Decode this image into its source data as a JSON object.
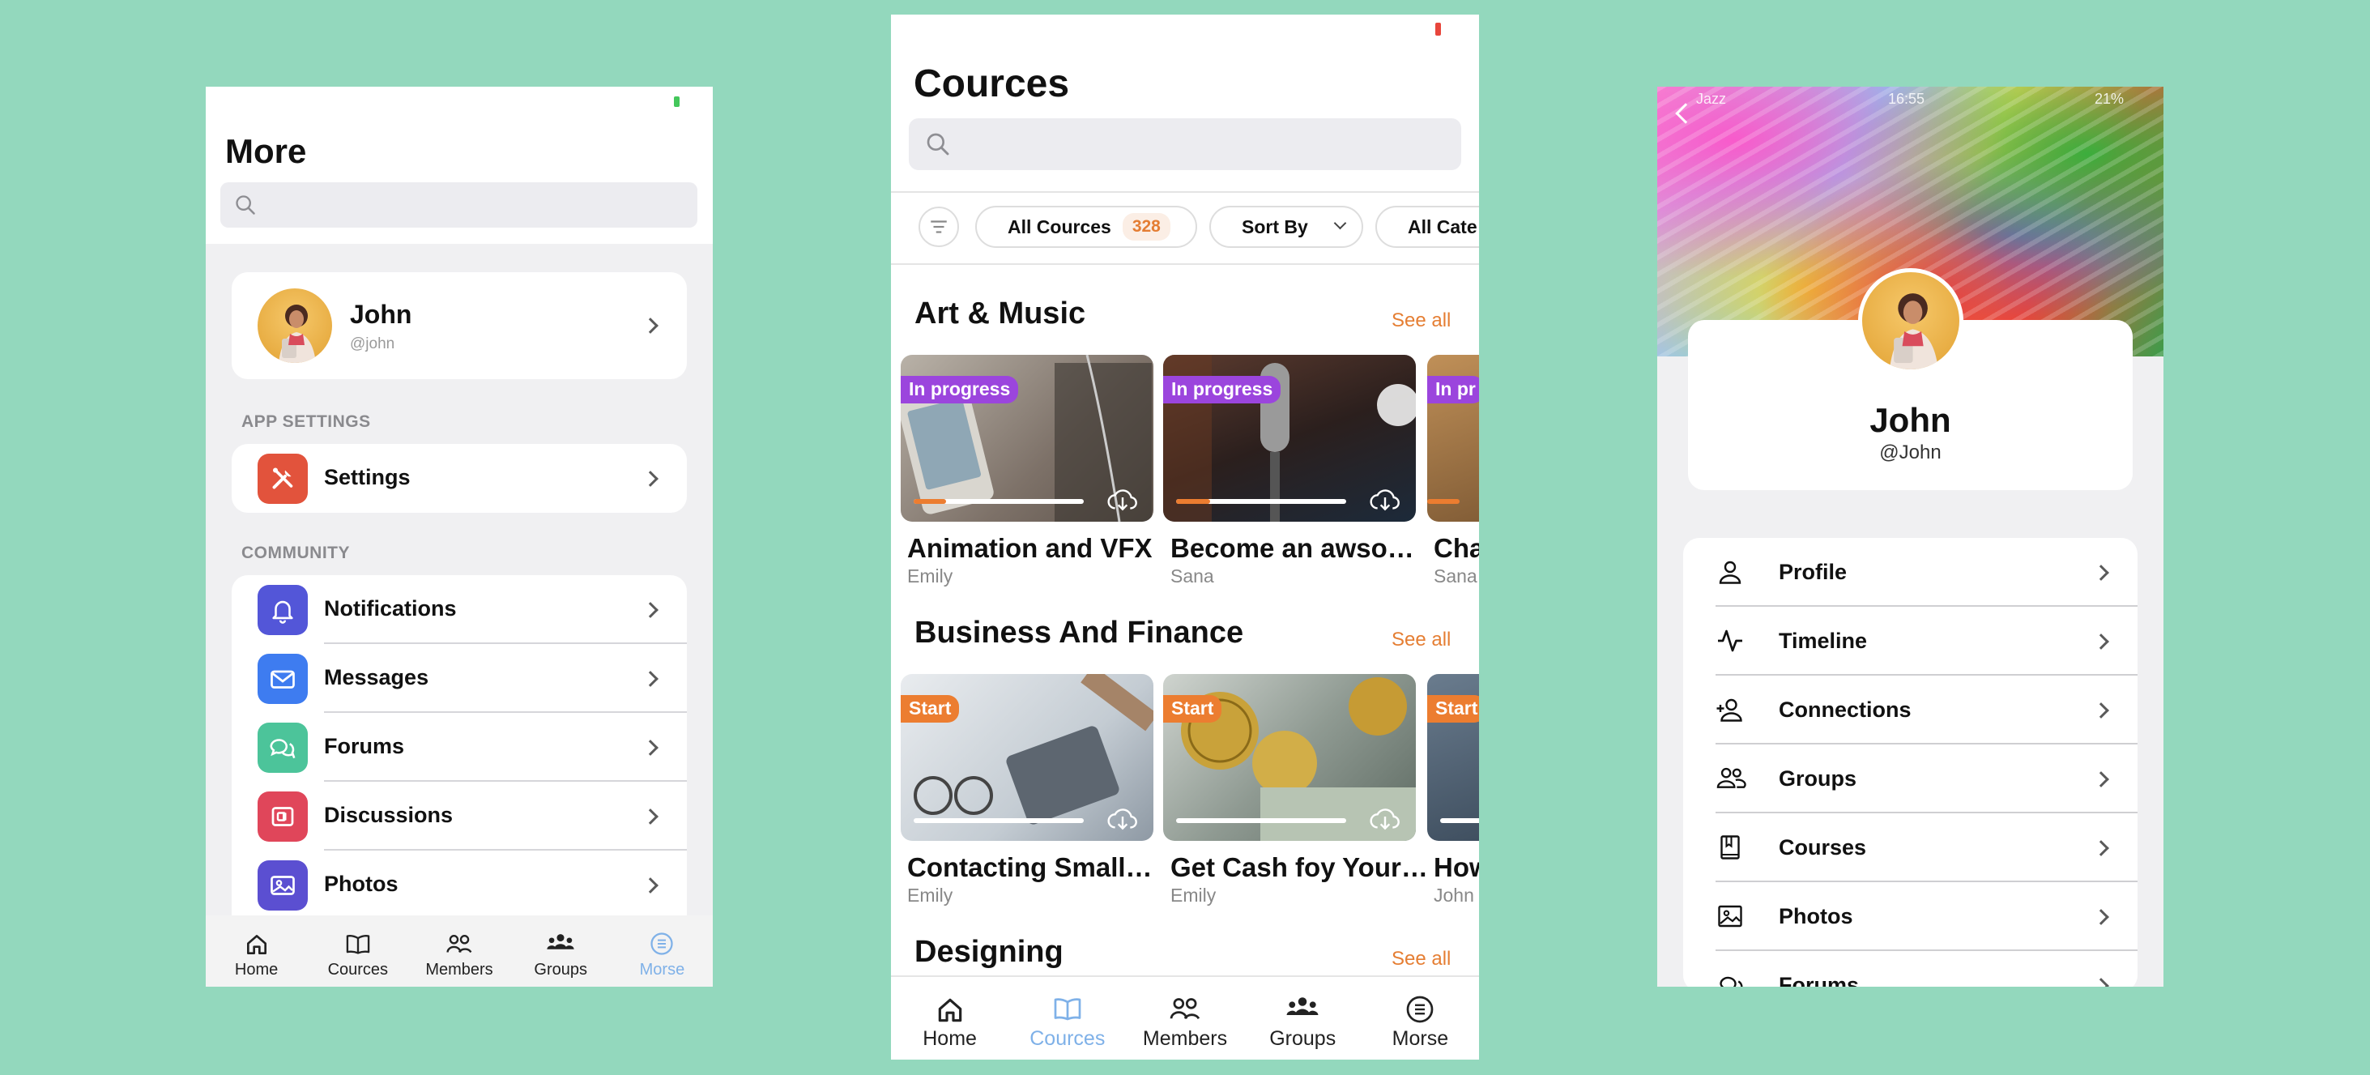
{
  "screen1": {
    "title": "More",
    "search_placeholder": "",
    "user": {
      "name": "John",
      "handle": "@john"
    },
    "section_app_settings": "APP SETTINGS",
    "settings_label": "Settings",
    "section_community": "COMMUNITY",
    "community_items": [
      {
        "label": "Notifications",
        "icon": "bell-icon",
        "color": "#5356d8"
      },
      {
        "label": "Messages",
        "icon": "mail-icon",
        "color": "#3e7cf0"
      },
      {
        "label": "Forums",
        "icon": "chat-icon",
        "color": "#4cc49a"
      },
      {
        "label": "Discussions",
        "icon": "discussion-icon",
        "color": "#e0465a"
      },
      {
        "label": "Photos",
        "icon": "photo-icon",
        "color": "#5b4fd1"
      }
    ],
    "settings_color": "#e2533c",
    "tabs": [
      {
        "label": "Home",
        "icon": "home-icon",
        "active": false
      },
      {
        "label": "Cources",
        "icon": "book-icon",
        "active": false
      },
      {
        "label": "Members",
        "icon": "members-icon",
        "active": false
      },
      {
        "label": "Groups",
        "icon": "groups-icon",
        "active": false
      },
      {
        "label": "Morse",
        "icon": "more-list-icon",
        "active": true
      }
    ]
  },
  "screen2": {
    "title": "Cources",
    "search_placeholder": "",
    "filters": {
      "all_label": "All Cources",
      "all_count": "328",
      "sort_label": "Sort By",
      "category_label": "All Cate"
    },
    "see_all": "See all",
    "sections": [
      {
        "title": "Art & Music",
        "courses": [
          {
            "title": "Animation and VFX",
            "author": "Emily",
            "tag": "In progress",
            "progress": 0.12
          },
          {
            "title": "Become an awso…",
            "author": "Sana",
            "tag": "In progress",
            "progress": 0.15
          },
          {
            "title": "Cha",
            "author": "Sana",
            "tag": "In pr",
            "progress": 0.1
          }
        ]
      },
      {
        "title": "Business And Finance",
        "courses": [
          {
            "title": "Contacting Small…",
            "author": "Emily",
            "tag": "Start",
            "progress": 0
          },
          {
            "title": "Get Cash foy Your…",
            "author": "Emily",
            "tag": "Start",
            "progress": 0
          },
          {
            "title": "How",
            "author": "John",
            "tag": "Start",
            "progress": 0
          }
        ]
      },
      {
        "title": "Designing"
      }
    ],
    "tabs": [
      {
        "label": "Home",
        "icon": "home-icon",
        "active": false
      },
      {
        "label": "Cources",
        "icon": "book-icon",
        "active": true
      },
      {
        "label": "Members",
        "icon": "members-icon",
        "active": false
      },
      {
        "label": "Groups",
        "icon": "groups-icon",
        "active": false
      },
      {
        "label": "Morse",
        "icon": "more-list-icon",
        "active": false
      }
    ]
  },
  "screen3": {
    "status": {
      "carrier": "Jazz",
      "time": "16:55",
      "battery": "21%"
    },
    "name": "John",
    "handle": "@John",
    "menu": [
      {
        "label": "Profile",
        "icon": "person-icon"
      },
      {
        "label": "Timeline",
        "icon": "activity-icon"
      },
      {
        "label": "Connections",
        "icon": "add-person-icon"
      },
      {
        "label": "Groups",
        "icon": "group-icon"
      },
      {
        "label": "Courses",
        "icon": "book-closed-icon"
      },
      {
        "label": "Photos",
        "icon": "photo-icon"
      },
      {
        "label": "Forums",
        "icon": "chat-icon"
      }
    ]
  },
  "colors": {
    "accent": "#e57e33",
    "progress_tag": "#9b45dd",
    "start_tag": "#ec7d30",
    "active_tab": "#7fb1e8",
    "background": "#93d8bd"
  }
}
